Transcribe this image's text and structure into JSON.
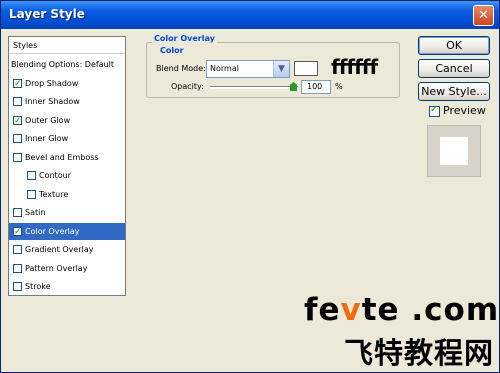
{
  "window": {
    "title": "Layer Style",
    "close_glyph": "✕"
  },
  "sidebar": {
    "header": "Styles",
    "items": [
      {
        "label": "Blending Options: Default",
        "checkbox": false,
        "checked": false,
        "selected": false
      },
      {
        "label": "Drop Shadow",
        "checkbox": true,
        "checked": true,
        "selected": false
      },
      {
        "label": "Inner Shadow",
        "checkbox": true,
        "checked": false,
        "selected": false
      },
      {
        "label": "Outer Glow",
        "checkbox": true,
        "checked": true,
        "selected": false
      },
      {
        "label": "Inner Glow",
        "checkbox": true,
        "checked": false,
        "selected": false
      },
      {
        "label": "Bevel and Emboss",
        "checkbox": true,
        "checked": false,
        "selected": false
      },
      {
        "label": "Contour",
        "checkbox": true,
        "checked": false,
        "selected": false
      },
      {
        "label": "Texture",
        "checkbox": true,
        "checked": false,
        "selected": false
      },
      {
        "label": "Satin",
        "checkbox": true,
        "checked": false,
        "selected": false
      },
      {
        "label": "Color Overlay",
        "checkbox": true,
        "checked": true,
        "selected": true
      },
      {
        "label": "Gradient Overlay",
        "checkbox": true,
        "checked": false,
        "selected": false
      },
      {
        "label": "Pattern Overlay",
        "checkbox": true,
        "checked": false,
        "selected": false
      },
      {
        "label": "Stroke",
        "checkbox": true,
        "checked": false,
        "selected": false
      }
    ]
  },
  "panel": {
    "group_title": "Color Overlay",
    "subgroup_title": "Color",
    "blend_mode_label": "Blend Mode:",
    "blend_mode_value": "Normal",
    "overlay_color": "#ffffff",
    "color_code_text": "ffffff",
    "opacity_label": "Opacity:",
    "opacity_value": "100",
    "opacity_fraction": 1.0,
    "opacity_unit": "%"
  },
  "buttons": {
    "ok": "OK",
    "cancel": "Cancel",
    "new_style": "New Style..."
  },
  "preview": {
    "label": "Preview",
    "checked": true
  },
  "watermark": {
    "site_prefix": "fe",
    "site_v": "v",
    "site_suffix": "te .com",
    "site_cn": "飞特教程网"
  },
  "colors": {
    "title_bar": "#0a5ce0",
    "selection": "#316ac5",
    "group_heading": "#0046d5",
    "dialog_bg": "#ece9d8",
    "watermark_accent": "#f26a10"
  }
}
